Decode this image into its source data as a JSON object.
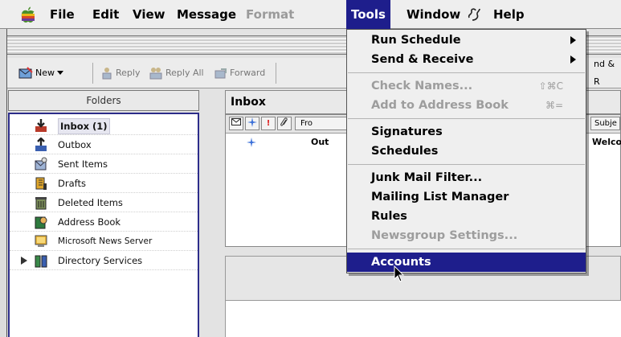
{
  "menubar": {
    "items": [
      {
        "label": "File",
        "state": "normal"
      },
      {
        "label": "Edit",
        "state": "normal"
      },
      {
        "label": "View",
        "state": "normal"
      },
      {
        "label": "Message",
        "state": "normal"
      },
      {
        "label": "Format",
        "state": "disabled"
      },
      {
        "label": "Tools",
        "state": "active"
      },
      {
        "label": "Window",
        "state": "normal"
      },
      {
        "label": "Help",
        "state": "normal"
      }
    ]
  },
  "toolbar": {
    "new_label": "New",
    "reply_label": "Reply",
    "reply_all_label": "Reply All",
    "forward_label": "Forward",
    "truncated_label": "nd & R"
  },
  "folders": {
    "header": "Folders",
    "items": [
      {
        "label": "Inbox (1)",
        "icon": "inbox-icon",
        "selected": true
      },
      {
        "label": "Outbox",
        "icon": "outbox-icon"
      },
      {
        "label": "Sent Items",
        "icon": "sent-items-icon"
      },
      {
        "label": "Drafts",
        "icon": "drafts-icon"
      },
      {
        "label": "Deleted Items",
        "icon": "trash-icon"
      },
      {
        "label": "Address Book",
        "icon": "address-book-icon"
      },
      {
        "label": "Microsoft News Server",
        "icon": "news-server-icon"
      },
      {
        "label": "Directory Services",
        "icon": "directory-icon",
        "collapsed": true
      }
    ]
  },
  "inbox": {
    "title": "Inbox",
    "columns": [
      "Fro",
      "Subje"
    ],
    "row": {
      "from": "Out",
      "subject": "Welco"
    }
  },
  "tools_menu": {
    "groups": [
      [
        {
          "label": "Run Schedule",
          "submenu": true
        },
        {
          "label": "Send & Receive",
          "submenu": true
        }
      ],
      [
        {
          "label": "Check Names...",
          "shortcut": "⇧⌘C",
          "disabled": true
        },
        {
          "label": "Add to Address Book",
          "shortcut": "⌘=",
          "disabled": true
        }
      ],
      [
        {
          "label": "Signatures"
        },
        {
          "label": "Schedules"
        }
      ],
      [
        {
          "label": "Junk Mail Filter..."
        },
        {
          "label": "Mailing List Manager"
        },
        {
          "label": "Rules"
        },
        {
          "label": "Newsgroup Settings...",
          "disabled": true
        }
      ],
      [
        {
          "label": "Accounts",
          "highlighted": true
        }
      ]
    ]
  },
  "colors": {
    "highlight": "#1e1e8c",
    "selection_border": "#2d2d8a"
  }
}
